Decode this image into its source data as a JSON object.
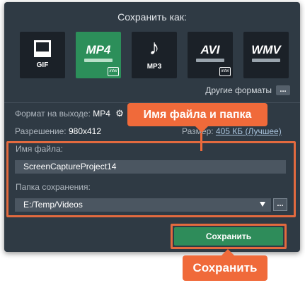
{
  "dialog": {
    "title": "Сохранить как:"
  },
  "formats": [
    {
      "id": "gif",
      "label": "GIF",
      "selected": false
    },
    {
      "id": "mp4",
      "label": "MP4",
      "selected": true,
      "badge": "intel"
    },
    {
      "id": "mp3",
      "label": "MP3",
      "selected": false
    },
    {
      "id": "avi",
      "label": "AVI",
      "selected": false,
      "badge": "intel"
    },
    {
      "id": "wmv",
      "label": "WMV",
      "selected": false
    }
  ],
  "other_formats": {
    "label": "Другие форматы",
    "button": "..."
  },
  "output": {
    "format_label": "Формат на выходе:",
    "format_value": "MP4",
    "resolution_label": "Разрешение:",
    "resolution_value": "980x412",
    "size_label": "Размер:",
    "size_value": "405 КБ (Лучшее)"
  },
  "file": {
    "name_label": "Имя файла:",
    "name_value": "ScreenCaptureProject14",
    "folder_label": "Папка сохранения:",
    "folder_value": "E:/Temp/Videos",
    "browse": "..."
  },
  "buttons": {
    "save": "Сохранить"
  },
  "callouts": {
    "file_and_folder": "Имя файла и папка",
    "save": "Сохранить"
  },
  "colors": {
    "accent": "#f06a3a",
    "save_green": "#2e8c5a",
    "dialog_bg": "#2f3a44"
  }
}
